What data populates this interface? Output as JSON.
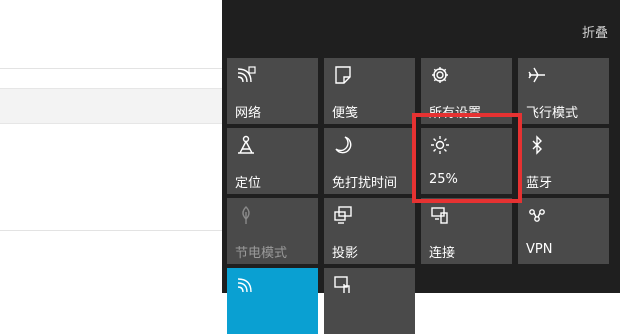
{
  "panel": {
    "collapse_label": "折叠",
    "background": "#1f1f1f",
    "tile_color": "#4a4a4a",
    "accent_color": "#0aa0d2",
    "highlight_color": "#e63232"
  },
  "tiles": [
    {
      "id": "network",
      "label": "网络",
      "icon": "wifi-icon"
    },
    {
      "id": "note",
      "label": "便笺",
      "icon": "note-icon"
    },
    {
      "id": "settings",
      "label": "所有设置",
      "icon": "gear-icon"
    },
    {
      "id": "airplane",
      "label": "飞行模式",
      "icon": "airplane-icon"
    },
    {
      "id": "location",
      "label": "定位",
      "icon": "location-icon"
    },
    {
      "id": "quiet-hours",
      "label": "免打扰时间",
      "icon": "moon-icon"
    },
    {
      "id": "brightness",
      "label": "25%",
      "icon": "sun-icon"
    },
    {
      "id": "bluetooth",
      "label": "蓝牙",
      "icon": "bluetooth-icon"
    },
    {
      "id": "battery-saver",
      "label": "节电模式",
      "icon": "leaf-icon",
      "disabled": true
    },
    {
      "id": "project",
      "label": "投影",
      "icon": "project-icon"
    },
    {
      "id": "connect",
      "label": "连接",
      "icon": "connect-icon"
    },
    {
      "id": "vpn",
      "label": "VPN",
      "icon": "vpn-icon"
    },
    {
      "id": "mobile-hotspot",
      "label": "",
      "icon": "wifi-icon",
      "active": true
    },
    {
      "id": "snip",
      "label": "",
      "icon": "snip-icon"
    }
  ]
}
